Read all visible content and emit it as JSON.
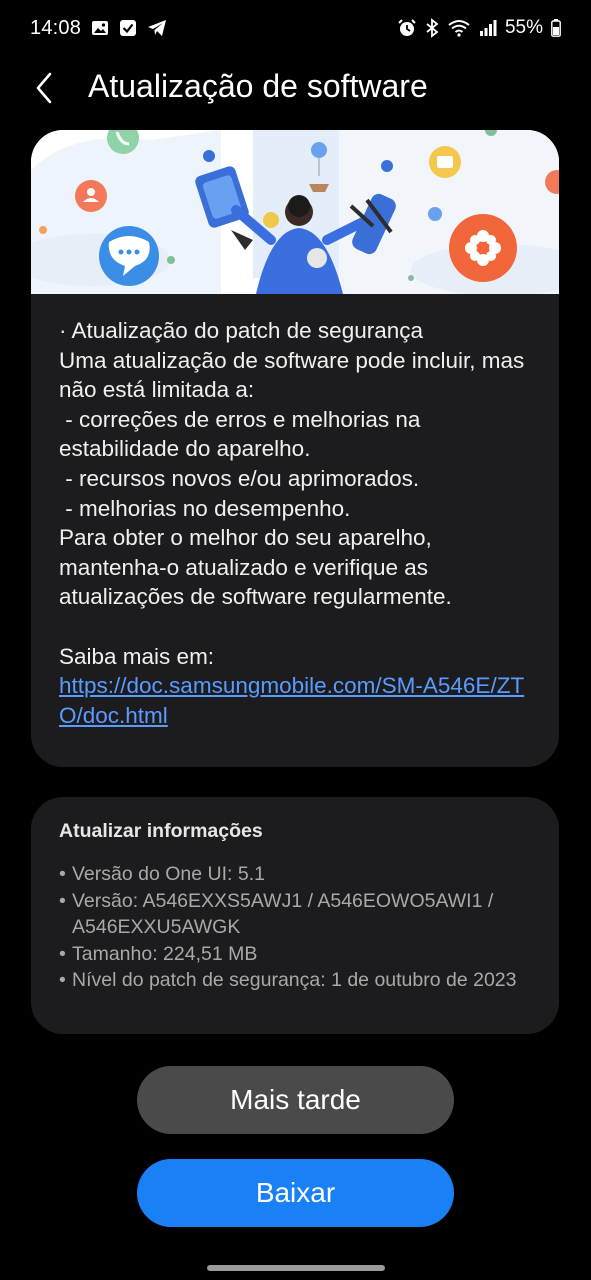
{
  "status_bar": {
    "time": "14:08",
    "battery": "55%",
    "left_icons": [
      "gallery-icon",
      "checkbox-icon",
      "telegram-icon"
    ],
    "right_icons": [
      "alarm-icon",
      "bluetooth-icon",
      "wifi-icon",
      "signal-icon",
      "battery-icon"
    ]
  },
  "header": {
    "title": "Atualização de software",
    "back_icon": "chevron-left-icon"
  },
  "banner": {
    "description_icons": [
      "phone-icon",
      "chat-bubble-icon",
      "flower-icon",
      "calendar-icon",
      "balloon-icon"
    ]
  },
  "main": {
    "lines": [
      "· Atualização do patch de segurança",
      "Uma atualização de software pode incluir, mas não está limitada a:",
      " - correções de erros e melhorias na estabilidade do aparelho.",
      " - recursos novos e/ou aprimorados.",
      " - melhorias no desempenho.",
      "Para obter o melhor do seu aparelho, mantenha-o atualizado e verifique as atualizações de software regularmente."
    ],
    "learn_more_label": "Saiba mais em:",
    "link": "https://doc.samsungmobile.com/SM-A546E/ZTO/doc.html"
  },
  "info": {
    "title": "Atualizar informações",
    "items": [
      "Versão do One UI: 5.1",
      "Versão: A546EXXS5AWJ1 / A546EOWO5AWI1 / A546EXXU5AWGK",
      "Tamanho: 224,51 MB",
      "Nível do patch de segurança: 1 de outubro de 2023"
    ]
  },
  "buttons": {
    "later": "Mais tarde",
    "download": "Baixar"
  },
  "colors": {
    "background": "#000000",
    "card": "#1c1c1e",
    "link": "#5a9bff",
    "primary_button": "#1a80f5",
    "secondary_button": "#4a4a4a"
  }
}
